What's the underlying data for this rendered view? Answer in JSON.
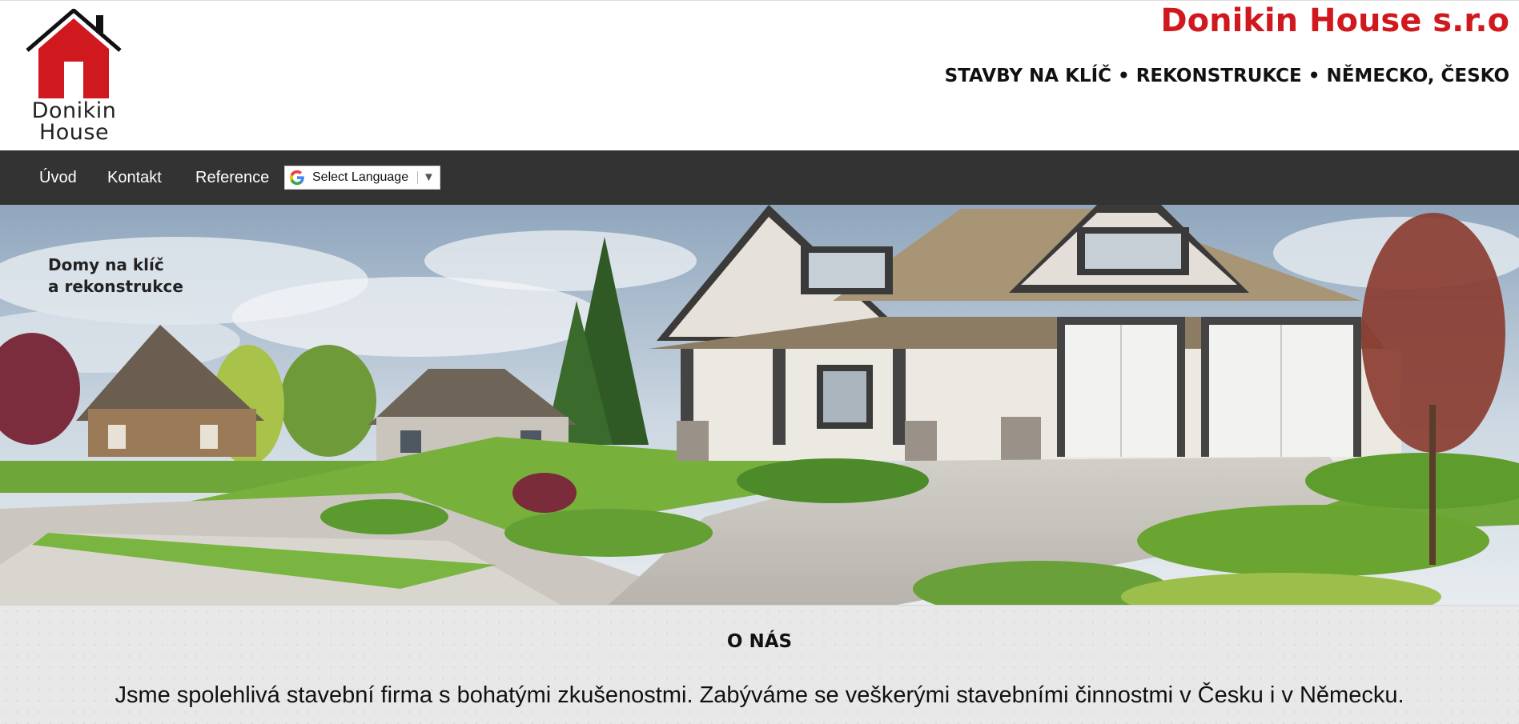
{
  "header": {
    "logo_line1": "Donikin",
    "logo_line2": "House",
    "company_name": "Donikin House s.r.o",
    "tagline": "STAVBY NA KLÍČ • REKONSTRUKCE • NĚMECKO, ČESKO"
  },
  "nav": {
    "items": [
      {
        "label": "Úvod"
      },
      {
        "label": "Kontakt"
      },
      {
        "label": "Reference"
      }
    ],
    "language_select": "Select Language"
  },
  "hero": {
    "line1": "Domy na klíč",
    "line2": "a rekonstrukce"
  },
  "about": {
    "title": "O NÁS",
    "text": "Jsme spolehlivá stavební firma s bohatými zkušenostmi. Zabýváme se veškerými stavebními činnostmi v Česku i v Německu."
  },
  "colors": {
    "brand_red": "#d0191f",
    "nav_bg": "#333333",
    "about_bg": "#e8e8e8"
  },
  "icons": {
    "logo": "house-logo-icon",
    "language": "google-g-icon",
    "dropdown": "triangle-down-icon"
  }
}
